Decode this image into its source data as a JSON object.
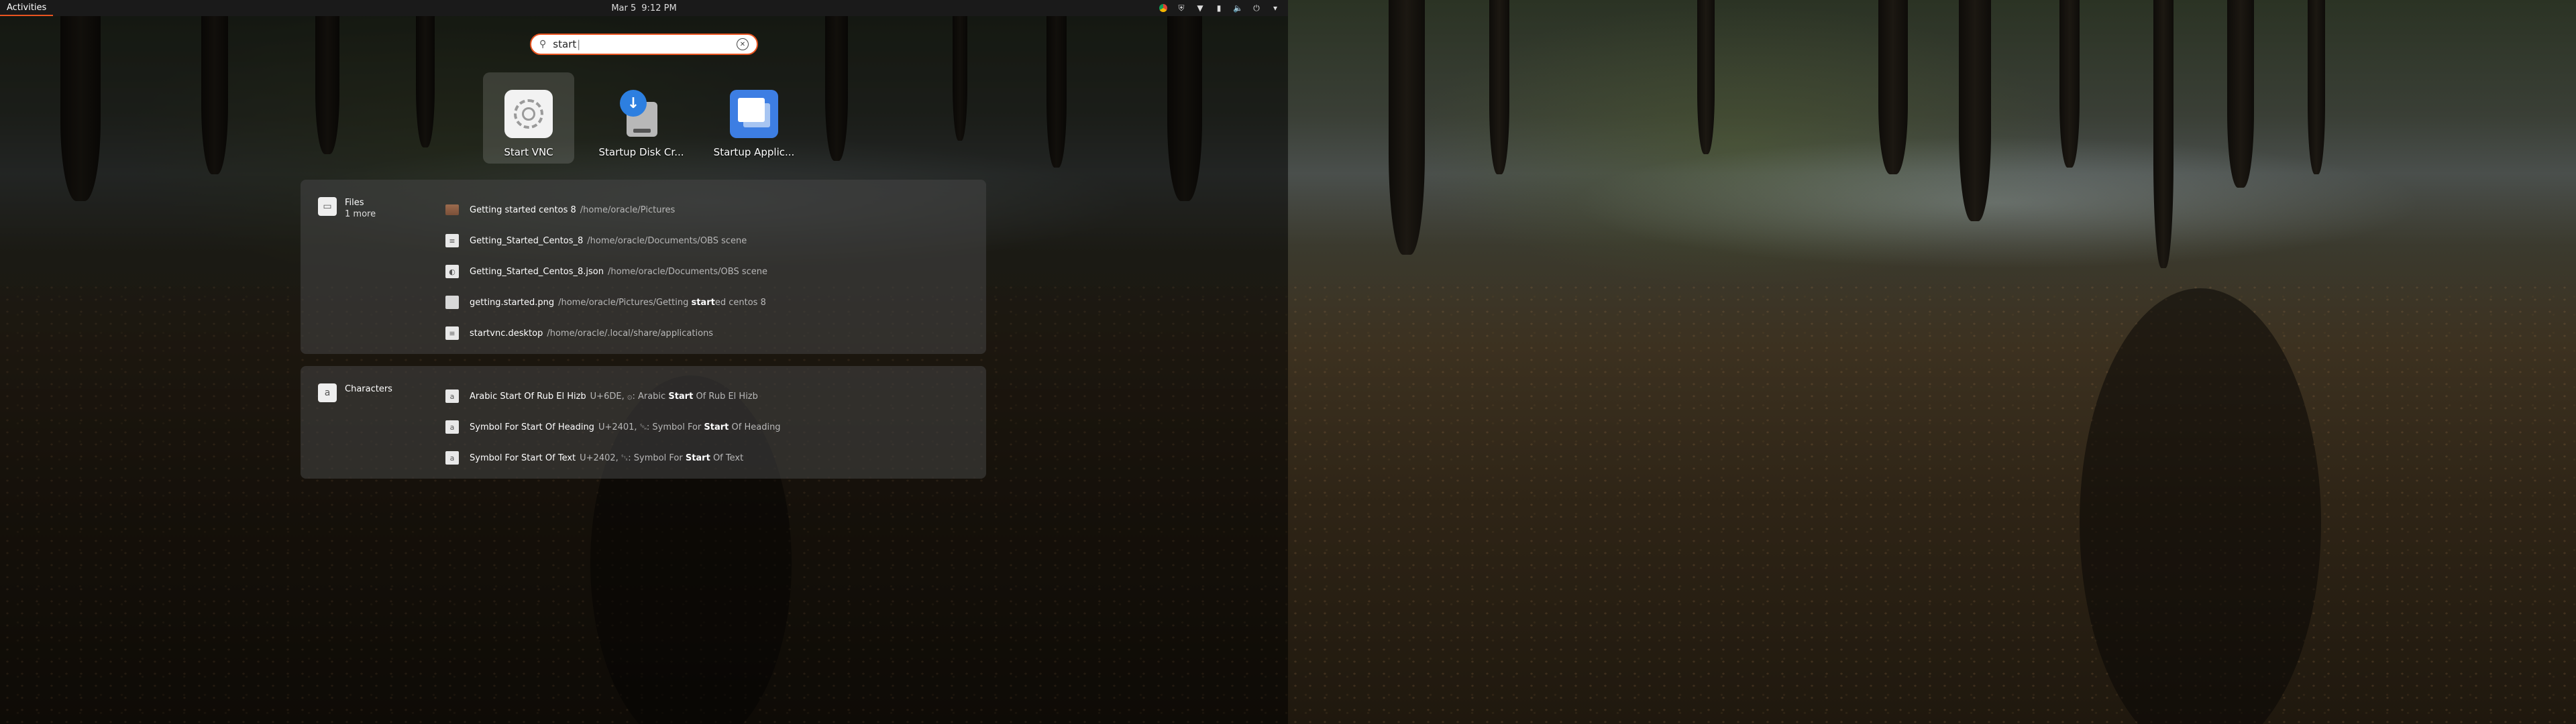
{
  "topbar": {
    "activities": "Activities",
    "date": "Mar 5",
    "time": "9:12 PM"
  },
  "search": {
    "value": "start"
  },
  "apps": [
    {
      "label": "Start VNC",
      "icon": "vnc-icon"
    },
    {
      "label": "Startup Disk Cr...",
      "icon": "startup-disk-creator-icon"
    },
    {
      "label": "Startup Applic...",
      "icon": "startup-applications-icon"
    }
  ],
  "files": {
    "provider_name": "Files",
    "provider_more": "1 more",
    "results": [
      {
        "title": "Getting started centos 8",
        "desc": "/home/oracle/Pictures",
        "icon": "folder"
      },
      {
        "title": "Getting_Started_Centos_8",
        "desc": "/home/oracle/Documents/OBS scene",
        "icon": "file"
      },
      {
        "title": "Getting_Started_Centos_8.json",
        "desc": "/home/oracle/Documents/OBS scene",
        "icon": "json"
      },
      {
        "title": "getting.started.png",
        "desc_pre": "/home/oracle/Pictures/Getting ",
        "desc_bold": "start",
        "desc_post": "ed centos 8",
        "icon": "image"
      },
      {
        "title": "startvnc.desktop",
        "desc": "/home/oracle/.local/share/applications",
        "icon": "file"
      }
    ]
  },
  "characters": {
    "provider_name": "Characters",
    "results": [
      {
        "title": "Arabic Start Of Rub El Hizb",
        "desc_pre": "U+6DE, ۞: Arabic ",
        "desc_bold": "Start",
        "desc_post": " Of Rub El Hizb"
      },
      {
        "title": "Symbol For Start Of Heading",
        "desc_pre": "U+2401, ␁: Symbol For ",
        "desc_bold": "Start",
        "desc_post": " Of Heading"
      },
      {
        "title": "Symbol For Start Of Text",
        "desc_pre": "U+2402, ␂: Symbol For ",
        "desc_bold": "Start",
        "desc_post": " Of Text"
      }
    ]
  }
}
